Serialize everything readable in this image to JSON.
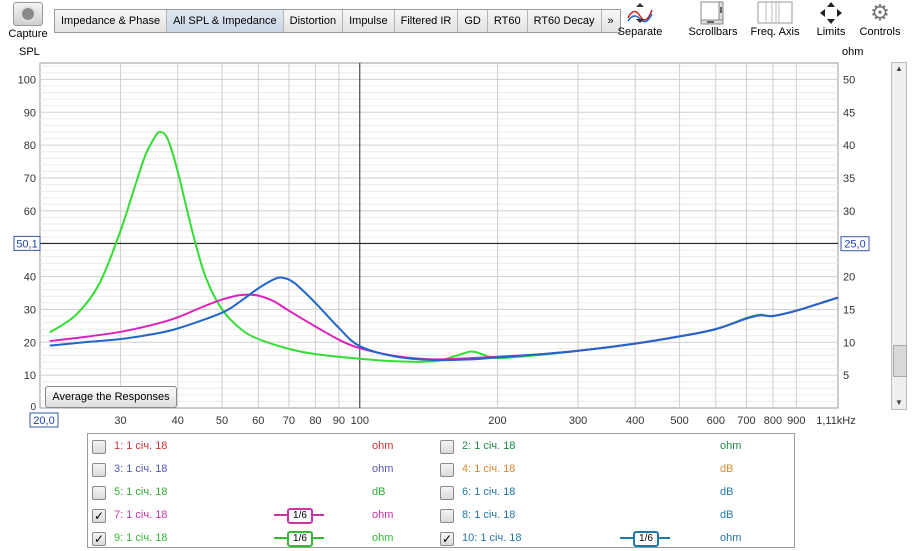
{
  "toolbar": {
    "capture_label": "Capture",
    "tabs": [
      "Impedance & Phase",
      "All SPL & Impedance",
      "Distortion",
      "Impulse",
      "Filtered IR",
      "GD",
      "RT60",
      "RT60 Decay",
      "»"
    ],
    "active_tab": "All SPL & Impedance",
    "tools": [
      {
        "label": "Separate",
        "icon": "separate-icon"
      },
      {
        "label": "Scrollbars",
        "icon": "scrollbars-icon"
      },
      {
        "label": "Freq. Axis",
        "icon": "freq-axis-icon"
      },
      {
        "label": "Limits",
        "icon": "limits-icon"
      },
      {
        "label": "Controls",
        "icon": "gear-icon"
      }
    ]
  },
  "plot": {
    "left_axis_title": "SPL",
    "right_axis_title": "ohm",
    "cursor_left": "50,1",
    "cursor_right": "25,0",
    "x_start_label": "20,0",
    "x_end_label": "1,11kHz",
    "average_button": "Average the Responses"
  },
  "chart_data": {
    "type": "line",
    "xscale": "log",
    "xlim": [
      20,
      1110
    ],
    "ylim_left": [
      0,
      105
    ],
    "ylim_right": [
      0,
      52.5
    ],
    "ylabel_left": "SPL",
    "ylabel_right": "ohm",
    "x_ticks": [
      30,
      40,
      50,
      60,
      70,
      80,
      90,
      100,
      200,
      300,
      400,
      500,
      600,
      700,
      800,
      900
    ],
    "x_tick_labels": [
      "30",
      "40",
      "50",
      "60",
      "70",
      "80",
      "90",
      "100",
      "200",
      "300",
      "400",
      "500",
      "600",
      "700",
      "800",
      "900"
    ],
    "y_left_ticks": [
      10,
      20,
      30,
      40,
      50,
      60,
      70,
      80,
      90,
      100
    ],
    "y_right_ticks": [
      5,
      10,
      15,
      20,
      25,
      30,
      35,
      40,
      45,
      50
    ],
    "cursor": {
      "x": 100,
      "y_left": 50.1,
      "y_right": 25.0
    },
    "grid": true,
    "series": [
      {
        "name": "9: 1 січ. 18",
        "unit": "ohm",
        "color": "#33dd33",
        "points": [
          [
            21,
            11.5
          ],
          [
            24,
            14.2
          ],
          [
            27,
            19
          ],
          [
            30,
            27
          ],
          [
            32,
            33
          ],
          [
            34,
            38.5
          ],
          [
            35.5,
            41
          ],
          [
            36.5,
            42
          ],
          [
            38,
            41
          ],
          [
            40,
            36
          ],
          [
            43,
            27
          ],
          [
            46,
            20
          ],
          [
            50,
            15
          ],
          [
            55,
            12
          ],
          [
            60,
            10.5
          ],
          [
            70,
            9
          ],
          [
            80,
            8.2
          ],
          [
            100,
            7.5
          ],
          [
            120,
            7.1
          ],
          [
            145,
            7.1
          ],
          [
            160,
            7.8
          ],
          [
            175,
            8.6
          ],
          [
            185,
            8.2
          ],
          [
            200,
            7.6
          ],
          [
            250,
            8.1
          ],
          [
            300,
            8.7
          ],
          [
            400,
            9.8
          ],
          [
            500,
            10.9
          ],
          [
            600,
            12
          ],
          [
            700,
            13.7
          ],
          [
            750,
            14.2
          ],
          [
            800,
            14
          ],
          [
            900,
            14.8
          ],
          [
            1000,
            15.8
          ],
          [
            1110,
            16.8
          ]
        ]
      },
      {
        "name": "7: 1 січ. 18",
        "unit": "ohm",
        "color": "#dd22bb",
        "points": [
          [
            21,
            10.2
          ],
          [
            25,
            10.8
          ],
          [
            30,
            11.6
          ],
          [
            35,
            12.6
          ],
          [
            40,
            13.8
          ],
          [
            45,
            15.3
          ],
          [
            50,
            16.5
          ],
          [
            55,
            17.2
          ],
          [
            60,
            17.1
          ],
          [
            65,
            16.2
          ],
          [
            70,
            14.8
          ],
          [
            80,
            12.4
          ],
          [
            90,
            10.4
          ],
          [
            100,
            9.1
          ],
          [
            120,
            7.9
          ],
          [
            145,
            7.4
          ],
          [
            175,
            7.6
          ],
          [
            200,
            7.8
          ],
          [
            250,
            8.2
          ],
          [
            300,
            8.7
          ],
          [
            400,
            9.8
          ],
          [
            500,
            10.9
          ],
          [
            600,
            12
          ],
          [
            700,
            13.6
          ],
          [
            750,
            14.1
          ],
          [
            800,
            14
          ],
          [
            900,
            14.8
          ],
          [
            1000,
            15.8
          ],
          [
            1110,
            16.8
          ]
        ]
      },
      {
        "name": "10: 1 січ. 18",
        "unit": "ohm",
        "color": "#2266cc",
        "points": [
          [
            21,
            9.5
          ],
          [
            25,
            10
          ],
          [
            30,
            10.5
          ],
          [
            35,
            11.2
          ],
          [
            40,
            12.1
          ],
          [
            50,
            14.5
          ],
          [
            55,
            16.3
          ],
          [
            60,
            18.2
          ],
          [
            65,
            19.6
          ],
          [
            68,
            19.8
          ],
          [
            72,
            19
          ],
          [
            80,
            16
          ],
          [
            90,
            12.2
          ],
          [
            100,
            9.4
          ],
          [
            120,
            7.8
          ],
          [
            145,
            7.3
          ],
          [
            175,
            7.4
          ],
          [
            200,
            7.7
          ],
          [
            250,
            8.2
          ],
          [
            300,
            8.7
          ],
          [
            400,
            9.8
          ],
          [
            500,
            10.9
          ],
          [
            600,
            12
          ],
          [
            700,
            13.6
          ],
          [
            750,
            14.1
          ],
          [
            800,
            14
          ],
          [
            900,
            14.8
          ],
          [
            1000,
            15.8
          ],
          [
            1110,
            16.8
          ]
        ]
      }
    ]
  },
  "legend": {
    "items": [
      {
        "id": "1",
        "name": "1: 1 січ. 18",
        "unit": "ohm",
        "checked": false,
        "color": "#cc3333",
        "unit_color": "#cc3333"
      },
      {
        "id": "2",
        "name": "2: 1 січ. 18",
        "unit": "ohm",
        "checked": false,
        "color": "#228844",
        "unit_color": "#228844"
      },
      {
        "id": "3",
        "name": "3: 1 січ. 18",
        "unit": "ohm",
        "checked": false,
        "color": "#5555bb",
        "unit_color": "#5555bb"
      },
      {
        "id": "4",
        "name": "4: 1 січ. 18",
        "unit": "dB",
        "checked": false,
        "color": "#dd8833",
        "unit_color": "#dd8833"
      },
      {
        "id": "5",
        "name": "5: 1 січ. 18",
        "unit": "dB",
        "checked": false,
        "color": "#33aa33",
        "unit_color": "#33aa33"
      },
      {
        "id": "6",
        "name": "6: 1 січ. 18",
        "unit": "dB",
        "checked": false,
        "color": "#2277aa",
        "unit_color": "#2277aa"
      },
      {
        "id": "7",
        "name": "7: 1 січ. 18",
        "unit": "ohm",
        "checked": true,
        "color": "#cc33aa",
        "unit_color": "#cc33aa",
        "smoothing": "1/6"
      },
      {
        "id": "8",
        "name": "8: 1 січ. 18",
        "unit": "dB",
        "checked": false,
        "color": "#2277aa",
        "unit_color": "#2277aa"
      },
      {
        "id": "9",
        "name": "9: 1 січ. 18",
        "unit": "ohm",
        "checked": true,
        "color": "#33bb33",
        "unit_color": "#33bb33",
        "smoothing": "1/6"
      },
      {
        "id": "10",
        "name": "10: 1 січ. 18",
        "unit": "ohm",
        "checked": true,
        "color": "#2277aa",
        "unit_color": "#2277aa",
        "smoothing": "1/6"
      }
    ],
    "check_mark": "✓"
  }
}
